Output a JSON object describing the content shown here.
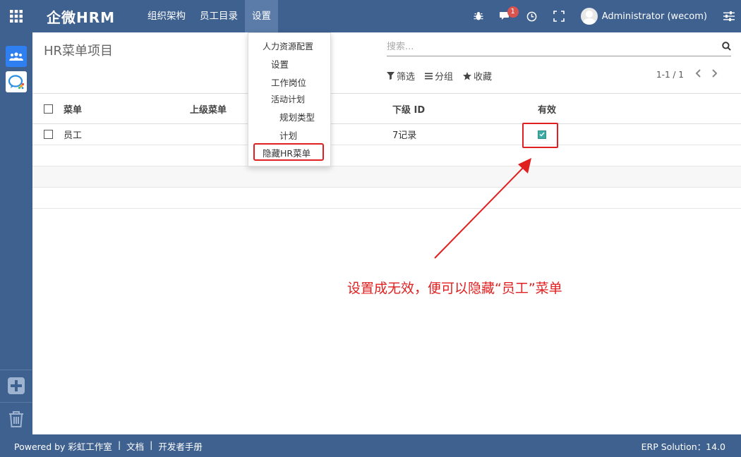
{
  "navbar": {
    "brand": "企微HRM",
    "menu": [
      "组织架构",
      "员工目录",
      "设置"
    ],
    "active_menu": "设置",
    "notification_count": "1",
    "user_name": "Administrator (wecom)"
  },
  "dropdown": {
    "section_header": "人力资源配置",
    "items": [
      "设置",
      "工作岗位"
    ],
    "sub_header": "活动计划",
    "sub_items": [
      "规划类型",
      "计划"
    ],
    "highlighted_item": "隐藏HR菜单"
  },
  "control_panel": {
    "breadcrumb": "HR菜单项目",
    "search_placeholder": "搜索...",
    "filters": [
      "筛选",
      "分组",
      "收藏"
    ],
    "pager": "1-1 / 1"
  },
  "table": {
    "columns": [
      "菜单",
      "上级菜单",
      "下级 ID",
      "有效"
    ],
    "rows": [
      {
        "menu": "员工",
        "parent": "",
        "child_ids": "7记录",
        "active": true
      }
    ]
  },
  "annotation": {
    "text": "设置成无效，便可以隐藏“员工”菜单",
    "color": "#e02020"
  },
  "footer": {
    "powered_by": "Powered by 彩虹工作室",
    "docs": "文档",
    "dev_manual": "开发者手册",
    "version": "ERP Solution：14.0"
  },
  "colors": {
    "navbar": "#3f6190",
    "active_menu": "#5b7ba8",
    "checkbox_on": "#3eaba4",
    "annotation": "#e02020"
  }
}
